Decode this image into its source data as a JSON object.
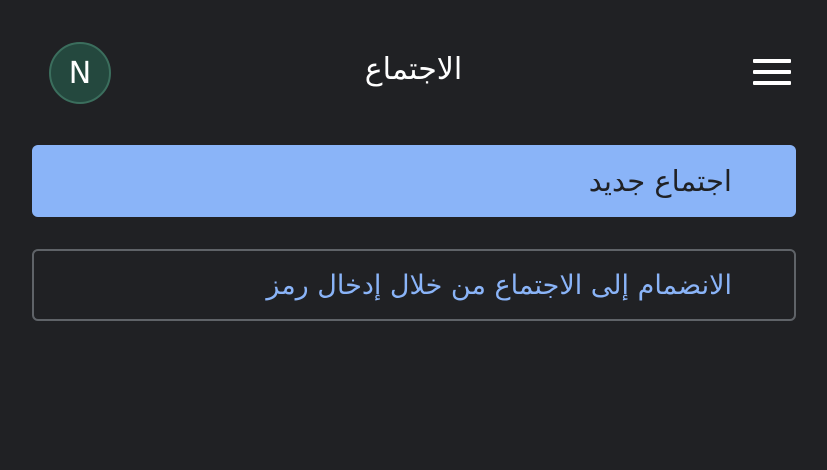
{
  "header": {
    "avatar_initial": "N",
    "title": "الاجتماع",
    "menu_icon": "hamburger-menu-icon"
  },
  "actions": {
    "new_meeting_label": "اجتماع جديد",
    "join_placeholder": "الانضمام إلى الاجتماع من خلال إدخال رمز"
  },
  "colors": {
    "background": "#202124",
    "accent": "#8ab4f8",
    "avatar_bg": "#24483e"
  }
}
